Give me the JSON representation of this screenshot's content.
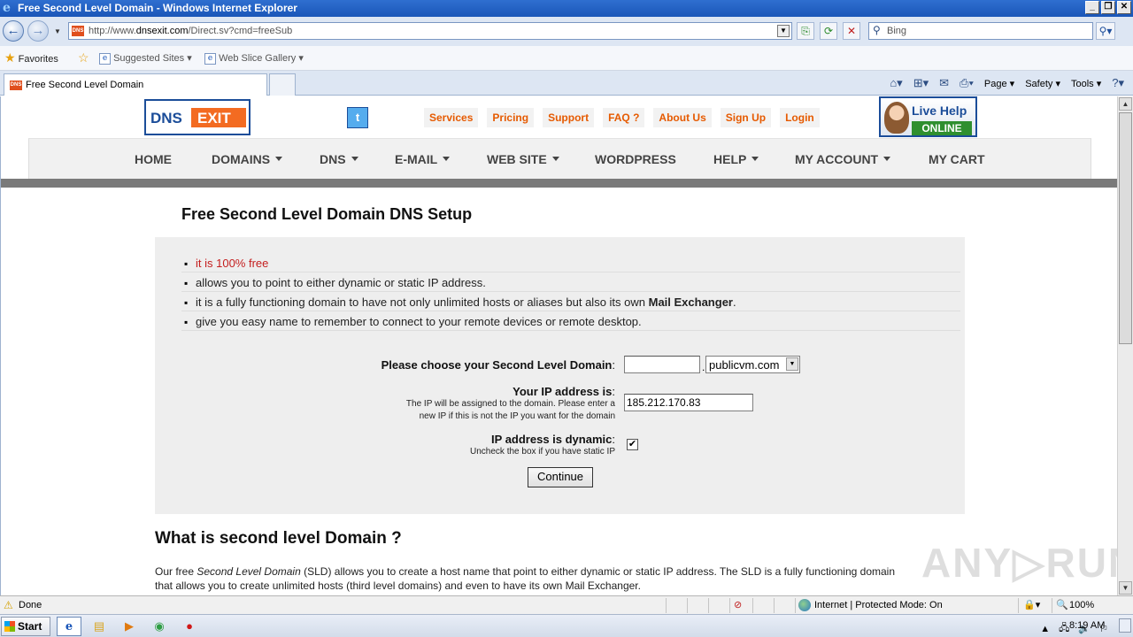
{
  "window": {
    "title": "Free Second Level Domain - Windows Internet Explorer",
    "buttons": [
      "_",
      "❐",
      "✕"
    ]
  },
  "address_bar": {
    "url_prefix": "http://www.",
    "url_domain": "dnsexit.com",
    "url_path": "/Direct.sv?cmd=freeSub",
    "search_placeholder": "Bing"
  },
  "favorites_bar": {
    "favorites_label": "Favorites",
    "suggested_sites": "Suggested Sites ▾",
    "web_slice_gallery": "Web Slice Gallery ▾"
  },
  "tab": {
    "label": "Free Second Level Domain"
  },
  "command_bar": {
    "page": "Page ▾",
    "safety": "Safety ▾",
    "tools": "Tools ▾",
    "help": "?"
  },
  "site": {
    "logo_left": "DNS",
    "logo_right": "EXIT",
    "top_links": [
      "Services",
      "Pricing",
      "Support",
      "FAQ ?",
      "About Us",
      "Sign Up",
      "Login"
    ],
    "live_help_1": "Live Help",
    "live_help_2": "ONLINE",
    "nav": {
      "home": "HOME",
      "domains": "DOMAINS",
      "dns": "DNS",
      "email": "E-MAIL",
      "website": "WEB SITE",
      "wordpress": "WORDPRESS",
      "help": "HELP",
      "account": "MY ACCOUNT",
      "cart": "MY CART"
    }
  },
  "content": {
    "heading": "Free Second Level Domain DNS Setup",
    "bullets": {
      "b1": "it is 100% free",
      "b2": "allows you to point to either dynamic or static IP address.",
      "b3_pre": "it is a fully functioning domain to have not only unlimited hosts or aliases but also its own ",
      "b3_bold": "Mail Exchanger",
      "b3_post": ".",
      "b4": "give you easy name to remember to connect to your remote devices or remote desktop."
    },
    "form": {
      "sld_label": "Please choose your Second Level Domain",
      "colon": ":",
      "sld_value": "",
      "domain_selected": "publicvm.com",
      "ip_label": "Your IP address is",
      "ip_help_1": "The IP will be assigned to the domain. Please enter a",
      "ip_help_2": "new IP if this is not the IP you want for the domain",
      "ip_value": "185.212.170.83",
      "dynamic_label": "IP address is dynamic",
      "dynamic_help": "Uncheck the box if you have static IP",
      "dynamic_checked": "✔",
      "continue": "Continue"
    },
    "what_heading": "What is second level Domain ?",
    "para_1": "Our free ",
    "para_em": "Second Level Domain",
    "para_2": " (SLD) allows you to create a host name that point to either dynamic or static IP address. The SLD is a fully functioning domain",
    "para_3": "that allows you to create unlimited hosts (third level domains) and even to have its own Mail Exchanger."
  },
  "watermark": "ANY▷RUN",
  "status_bar": {
    "status": "Done",
    "zone": "Internet | Protected Mode: On",
    "zoom": "100%"
  },
  "taskbar": {
    "start": "Start",
    "clock": "8:19 AM"
  }
}
